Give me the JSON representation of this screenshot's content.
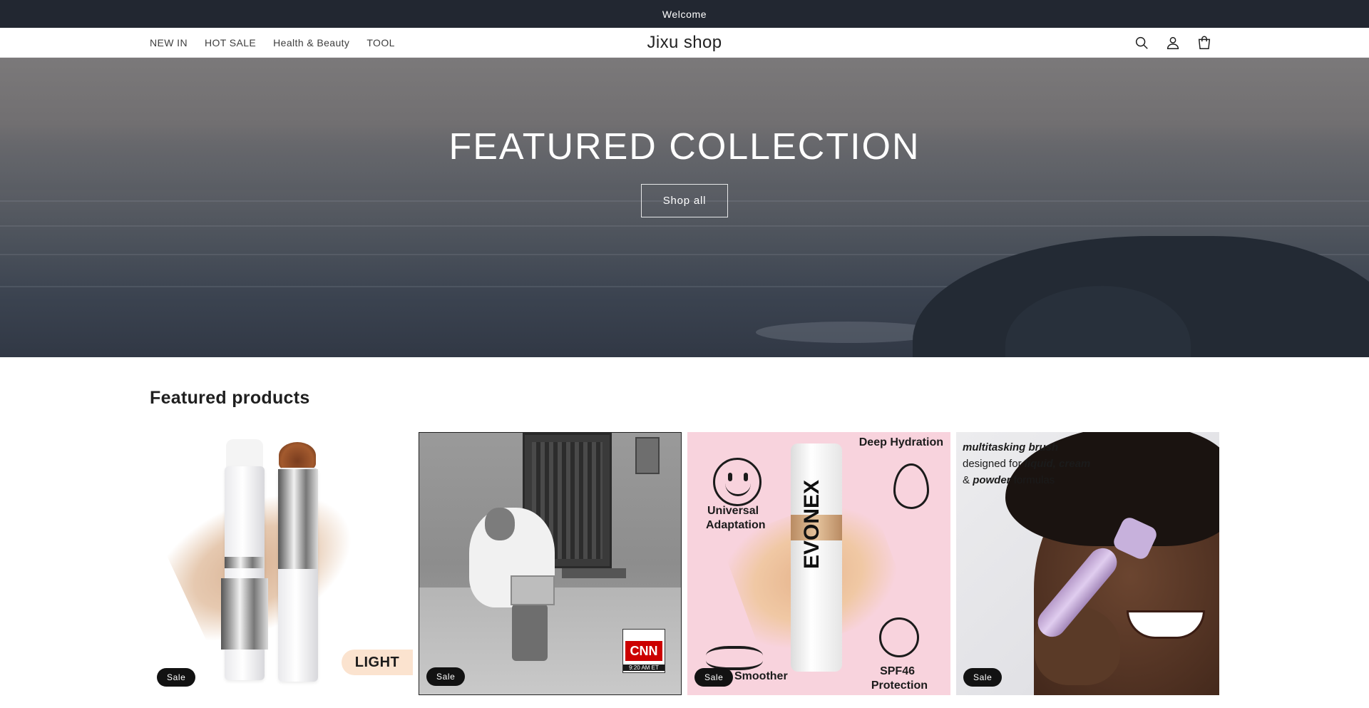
{
  "announcement": {
    "text": "Welcome"
  },
  "header": {
    "nav": [
      "NEW IN",
      "HOT SALE",
      "Health & Beauty",
      "TOOL"
    ],
    "logo": "Jixu shop",
    "icons": {
      "search": "search-icon",
      "account": "account-icon",
      "cart": "cart-icon"
    }
  },
  "hero": {
    "title": "FEATURED COLLECTION",
    "button": "Shop all"
  },
  "featured": {
    "heading": "Featured products",
    "products": [
      {
        "badge": "Sale",
        "image_text": "LIGHT"
      },
      {
        "badge": "Sale",
        "image_text": "CNN",
        "image_time": "9:20 AM ET"
      },
      {
        "badge": "Sale",
        "image_texts": [
          "Deep Hydration",
          "Universal",
          "Adaptation",
          "EVONEX",
          "Smoother",
          "SPF46",
          "Protection"
        ]
      },
      {
        "badge": "Sale",
        "image_texts": [
          "multitasking brush",
          "designed for",
          "liquid, cream",
          "&",
          "powder",
          "formulas"
        ]
      }
    ]
  },
  "colors": {
    "announcement_bg": "#222731",
    "badge_bg": "#121212",
    "hero_text": "#ffffff"
  }
}
